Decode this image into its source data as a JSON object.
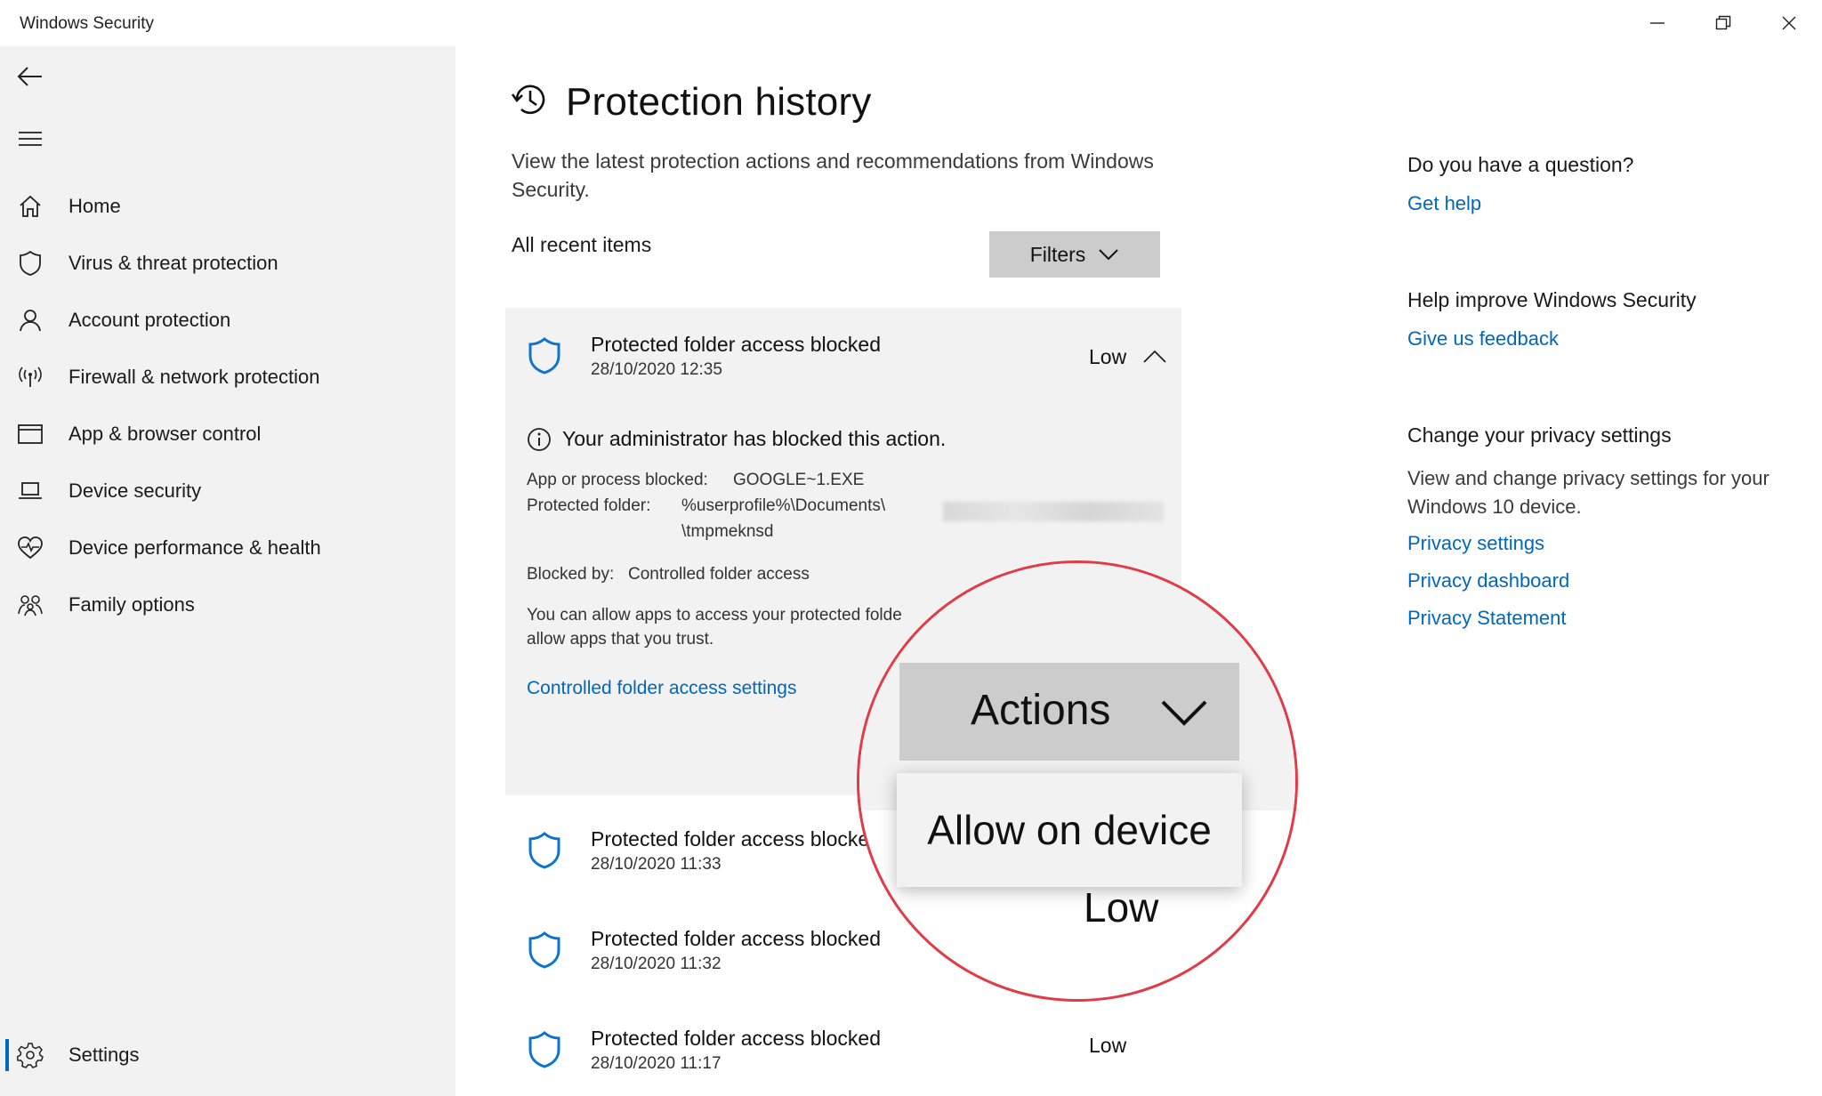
{
  "window": {
    "title": "Windows Security"
  },
  "sidebar": {
    "items": [
      {
        "label": "Home",
        "icon": "home-icon"
      },
      {
        "label": "Virus & threat protection",
        "icon": "shield-icon"
      },
      {
        "label": "Account protection",
        "icon": "person-icon"
      },
      {
        "label": "Firewall & network protection",
        "icon": "wireless-icon"
      },
      {
        "label": "App & browser control",
        "icon": "browser-window-icon"
      },
      {
        "label": "Device security",
        "icon": "laptop-icon"
      },
      {
        "label": "Device performance & health",
        "icon": "heart-pulse-icon"
      },
      {
        "label": "Family options",
        "icon": "family-icon"
      }
    ],
    "settings_label": "Settings"
  },
  "main": {
    "title": "Protection history",
    "description": "View the latest protection actions and recommendations from Windows Security.",
    "recent_label": "All recent items",
    "filters_label": "Filters",
    "expanded_item": {
      "title": "Protected folder access blocked",
      "date": "28/10/2020 12:35",
      "severity": "Low",
      "admin_notice": "Your administrator has blocked this action.",
      "app_blocked_label": "App or process blocked:",
      "app_blocked_value": "GOOGLE~1.EXE",
      "protected_folder_label": "Protected folder:",
      "protected_folder_value_line1": "%userprofile%\\Documents\\",
      "protected_folder_value_line2": "\\tmpmeknsd",
      "blocked_by_label": "Blocked by:",
      "blocked_by_value": "Controlled folder access",
      "allow_text_line1": "You can allow apps to access your protected folde",
      "allow_text_line2": "allow apps that you trust.",
      "settings_link": "Controlled folder access settings"
    },
    "items": [
      {
        "title": "Protected folder access blocke",
        "date": "28/10/2020 11:33"
      },
      {
        "title": "Protected folder access blocked",
        "date": "28/10/2020 11:32"
      },
      {
        "title": "Protected folder access blocked",
        "date": "28/10/2020 11:17",
        "severity": "Low"
      }
    ]
  },
  "magnifier": {
    "actions_label": "Actions",
    "menu_item": "Allow on device",
    "severity": "Low",
    "ring_color": "#e23a46"
  },
  "right_panel": {
    "question_heading": "Do you have a question?",
    "get_help": "Get help",
    "improve_heading": "Help improve Windows Security",
    "feedback_link": "Give us feedback",
    "privacy_heading": "Change your privacy settings",
    "privacy_text": "View and change privacy settings for your Windows 10 device.",
    "privacy_links": [
      "Privacy settings",
      "Privacy dashboard",
      "Privacy Statement"
    ]
  },
  "colors": {
    "accent": "#0067c0",
    "shield": "#0a74d0",
    "sidebar_bg": "#f2f2f2",
    "button_bg": "#cccccc"
  }
}
